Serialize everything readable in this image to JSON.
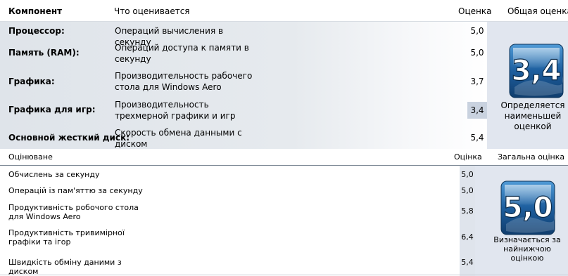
{
  "rating_ru": {
    "header": {
      "component": "Компонент",
      "what": "Что оценивается",
      "score": "Оценка",
      "base": "Общая оценка"
    },
    "rows": [
      {
        "component": "Процессор:",
        "description": "Операций вычисления в секунду",
        "score": "5,0"
      },
      {
        "component": "Память (RAM):",
        "description": "Операций доступа к памяти в секунду",
        "score": "5,0"
      },
      {
        "component": "Графика:",
        "description": "Производительность рабочего стола для Windows Aero",
        "score": "3,7"
      },
      {
        "component": "Графика для игр:",
        "description": "Производительность трехмерной графики и игр",
        "score": "3,4"
      },
      {
        "component": "Основной жесткий диск:",
        "description": "Скорость обмена данными с диском",
        "score": "5,4"
      }
    ],
    "base_score": "3,4",
    "base_caption": "Определяется наименьшей оценкой",
    "accent": "#1d5e9e"
  },
  "rating_uk": {
    "header": {
      "what": "Оцінюване",
      "score": "Оцінка",
      "base": "Загальна оцінка"
    },
    "rows": [
      {
        "description": "Обчислень за секунду",
        "score": "5,0"
      },
      {
        "description": "Операцій із пам'яттю за секунду",
        "score": "5,0"
      },
      {
        "description": "Продуктивність робочого стола для Windows Aero",
        "score": "5,8"
      },
      {
        "description": "Продуктивність тривимірної графіки та ігор",
        "score": "6,4"
      },
      {
        "description": "Швидкість обміну даними з диском",
        "score": "5,4"
      }
    ],
    "base_score": "5,0",
    "base_caption": "Визначається за найнижчою оцінкою",
    "accent": "#1d5e9e"
  }
}
